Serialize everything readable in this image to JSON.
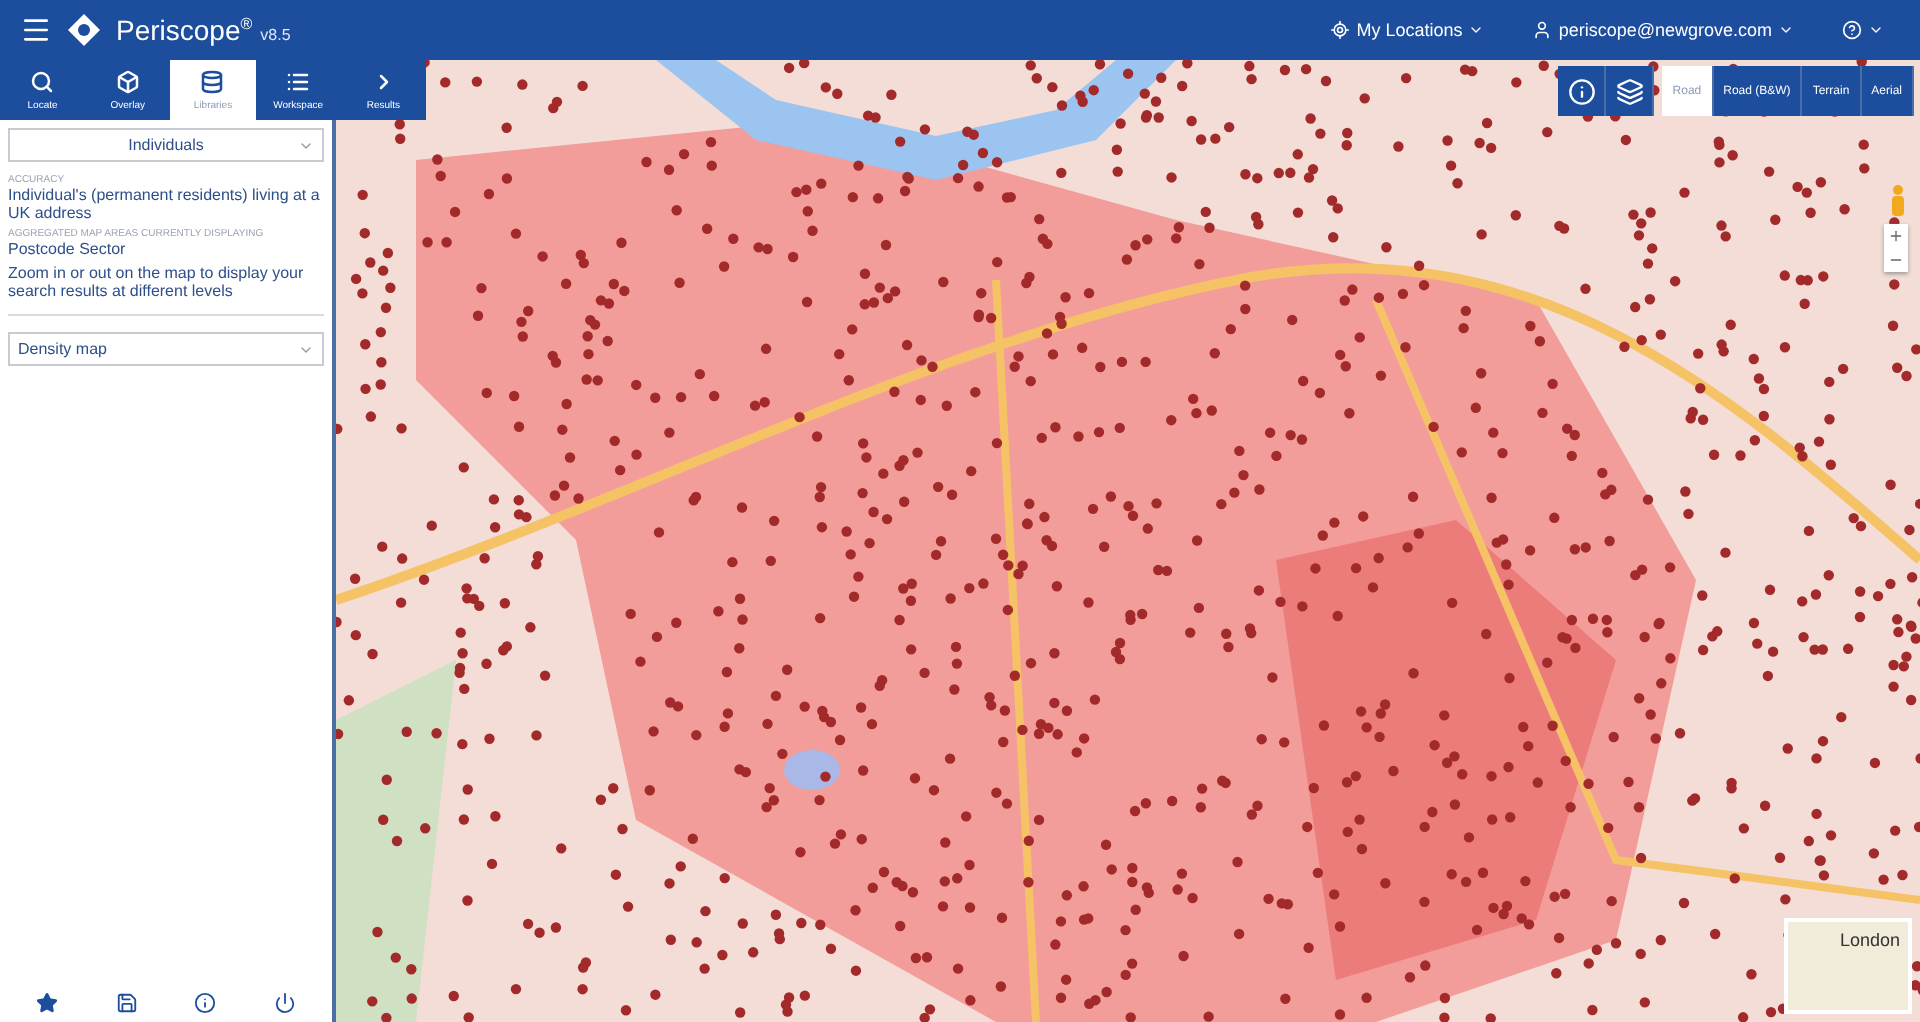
{
  "header": {
    "title": "Periscope$^{®}$",
    "version": "v8.5",
    "menus": [
      {
        "kind": "locations",
        "label": "My Locations"
      },
      {
        "kind": "user",
        "label": "periscope@newgrove.com"
      },
      {
        "kind": "help"
      }
    ]
  },
  "tabs": [
    {
      "kind": "search",
      "label": "Locate",
      "selected": false
    },
    {
      "kind": "overlay",
      "label": "Overlay",
      "selected": false
    },
    {
      "kind": "database",
      "label": "Libraries",
      "selected": true
    },
    {
      "kind": "list",
      "label": "Workspace",
      "selected": false
    },
    {
      "kind": "chevron",
      "label": "Results",
      "selected": false
    }
  ],
  "sidebar": {
    "dataset": {
      "value": "Individuals"
    },
    "sections": [
      {
        "heading": "ACCURACY",
        "text": "Individual's (permanent residents) living at a UK address"
      },
      {
        "heading": "AGGREGATED MAP AREAS CURRENTLY DISPLAYING",
        "text": "Postcode Sector"
      }
    ],
    "hint": "Zoom in or out on the map to display your search results at different levels",
    "display": {
      "value": "Density map"
    },
    "footer": [
      {
        "kind": "star"
      },
      {
        "kind": "save"
      },
      {
        "kind": "info"
      },
      {
        "kind": "power"
      }
    ]
  },
  "map": {
    "map_types": [
      {
        "label": "Road",
        "selected": true
      },
      {
        "label": "Road (B&W)",
        "selected": false
      },
      {
        "label": "Terrain",
        "selected": false
      },
      {
        "label": "Aerial",
        "selected": false
      }
    ],
    "inset": {
      "label": "London"
    }
  }
}
